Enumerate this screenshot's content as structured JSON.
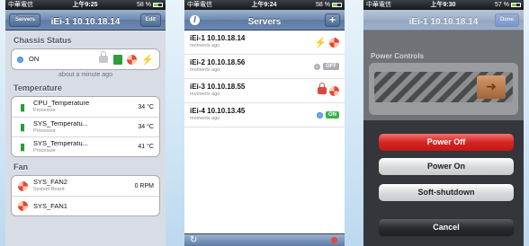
{
  "screen1": {
    "status": {
      "carrier": "中華電信",
      "time": "上午9:25",
      "battery": "58 %"
    },
    "nav": {
      "back": "Servers",
      "title": "iEi-1 10.10.18.14",
      "edit": "Edit"
    },
    "chassis": {
      "heading": "Chassis Status",
      "state": "ON",
      "updated": "about a minute ago"
    },
    "temperature": {
      "heading": "Temperature",
      "rows": [
        {
          "name": "CPU_Temperature",
          "sub": "Processor",
          "value": "34 °C"
        },
        {
          "name": "SYS_Temperatu...",
          "sub": "Processor",
          "value": "34 °C"
        },
        {
          "name": "SYS_Temperatu...",
          "sub": "Processor",
          "value": "41 °C"
        }
      ]
    },
    "fan": {
      "heading": "Fan",
      "rows": [
        {
          "name": "SYS_FAN2",
          "sub": "System Board",
          "value": "0 RPM"
        },
        {
          "name": "SYS_FAN1",
          "sub": "",
          "value": ""
        }
      ]
    }
  },
  "screen2": {
    "status": {
      "carrier": "中華電信",
      "time": "上午9:24",
      "battery": "58 %"
    },
    "nav": {
      "title": "Servers",
      "add": "+",
      "info": "i"
    },
    "servers": [
      {
        "name": "iEi-1 10.10.18.14",
        "time": "moments ago"
      },
      {
        "name": "iEi-2 10.10.18.56",
        "time": "moments ago",
        "badge": "OFF"
      },
      {
        "name": "iEi-3 10.10.18.55",
        "time": "moments ago"
      },
      {
        "name": "iEi-4 10.10.13.45",
        "time": "moments ago",
        "badge": "ON"
      }
    ],
    "toolbar": {
      "refresh": "↻"
    }
  },
  "screen3": {
    "status": {
      "carrier": "中華電信",
      "time": "上午9:30",
      "battery": "57 %"
    },
    "nav": {
      "title": "iEi-1 10.10.18.14",
      "done": "Done"
    },
    "power_controls": {
      "heading": "Power Controls",
      "knob": "➜"
    },
    "actions": {
      "power_off": "Power Off",
      "power_on": "Power On",
      "soft_shutdown": "Soft-shutdown",
      "cancel": "Cancel"
    }
  }
}
